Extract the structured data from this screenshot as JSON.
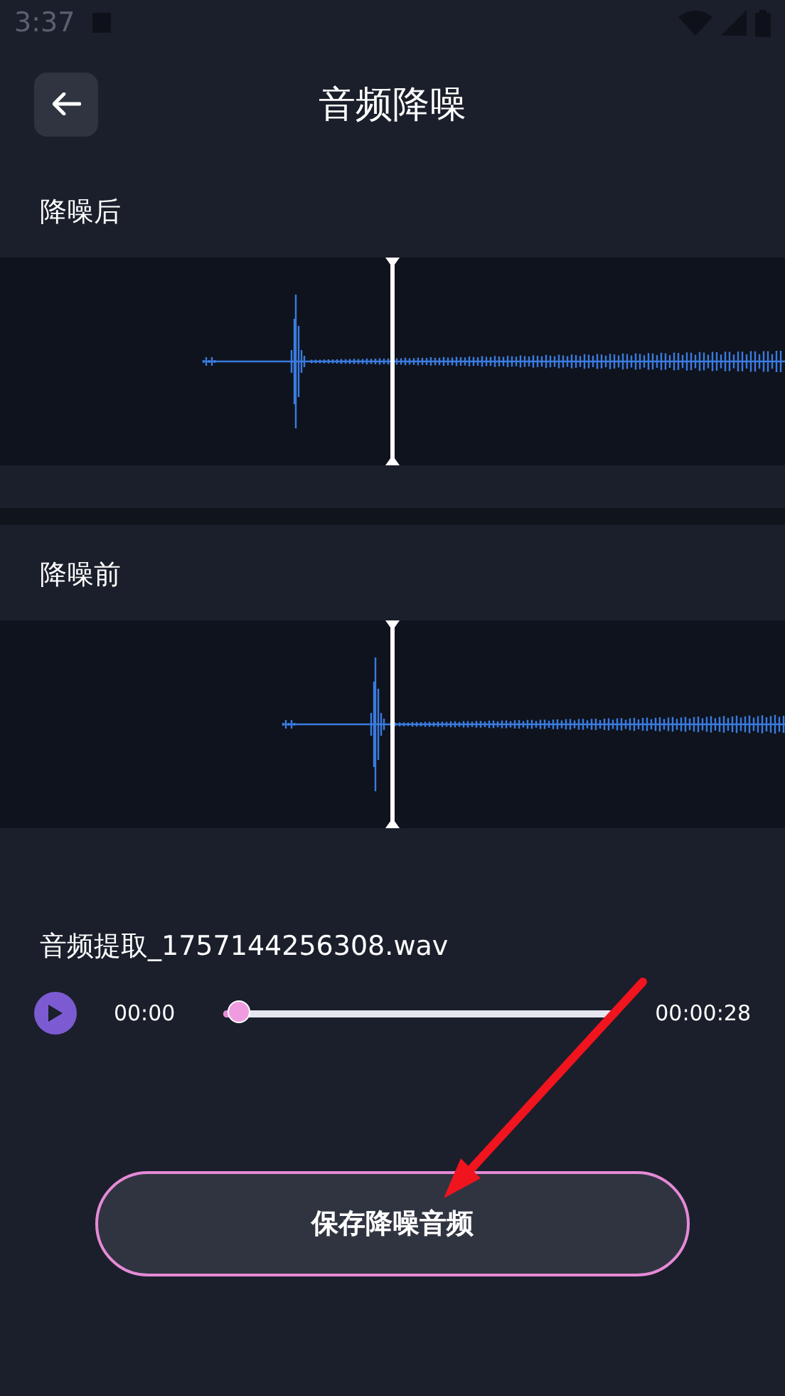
{
  "status_bar": {
    "time": "3:37"
  },
  "header": {
    "title": "音频降噪"
  },
  "sections": [
    {
      "label": "降噪后"
    },
    {
      "label": "降噪前"
    }
  ],
  "player": {
    "file_name": "音频提取_1757144256308.wav",
    "playing": false,
    "current_time": "00:00",
    "total_time": "00:00:28",
    "level": 0.04
  },
  "save_button": {
    "label": "保存降噪音频"
  }
}
